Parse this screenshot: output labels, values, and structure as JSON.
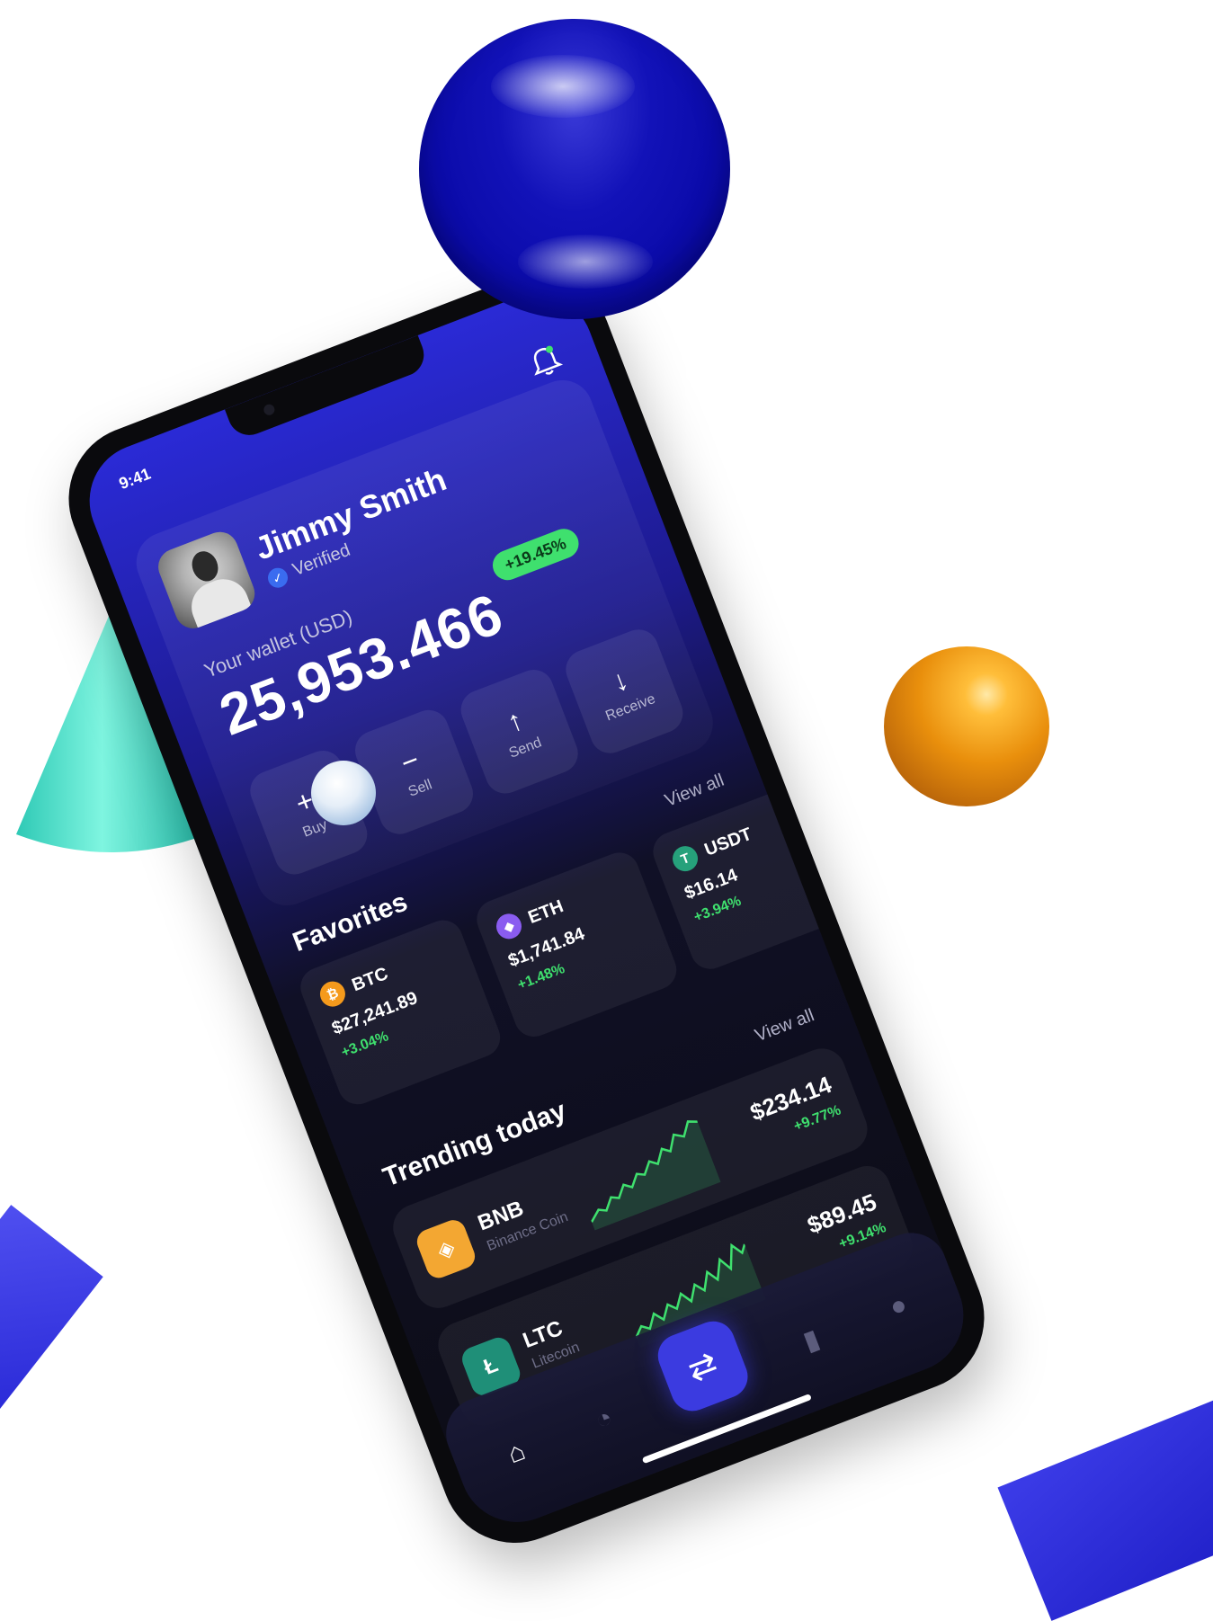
{
  "status": {
    "time": "9:41"
  },
  "profile": {
    "name": "Jimmy Smith",
    "status": "Verified"
  },
  "wallet": {
    "label": "Your wallet (USD)",
    "amount": "25,953.466",
    "change": "+19.45%"
  },
  "actions": [
    {
      "label": "Buy",
      "icon": "plus-icon"
    },
    {
      "label": "Sell",
      "icon": "minus-icon"
    },
    {
      "label": "Send",
      "icon": "arrow-up-icon"
    },
    {
      "label": "Receive",
      "icon": "arrow-down-icon"
    }
  ],
  "favorites": {
    "title": "Favorites",
    "view_all": "View all",
    "items": [
      {
        "symbol": "BTC",
        "price": "$27,241.89",
        "change": "+3.04%",
        "color": "#f59a1c"
      },
      {
        "symbol": "ETH",
        "price": "$1,741.84",
        "change": "+1.48%",
        "color": "#8a5cf0"
      },
      {
        "symbol": "USDT",
        "price": "$16.14",
        "change": "+3.94%",
        "color": "#26a17b"
      }
    ]
  },
  "trending": {
    "title": "Trending today",
    "view_all": "View all",
    "items": [
      {
        "symbol": "BNB",
        "name": "Binance Coin",
        "price": "$234.14",
        "change": "+9.77%",
        "color": "#f3a732"
      },
      {
        "symbol": "LTC",
        "name": "Litecoin",
        "price": "$89.45",
        "change": "+9.14%",
        "color": "#1f8f78"
      }
    ]
  },
  "tabbar": [
    "home-icon",
    "pie-chart-icon",
    "swap-icon",
    "bar-chart-icon",
    "profile-icon"
  ]
}
